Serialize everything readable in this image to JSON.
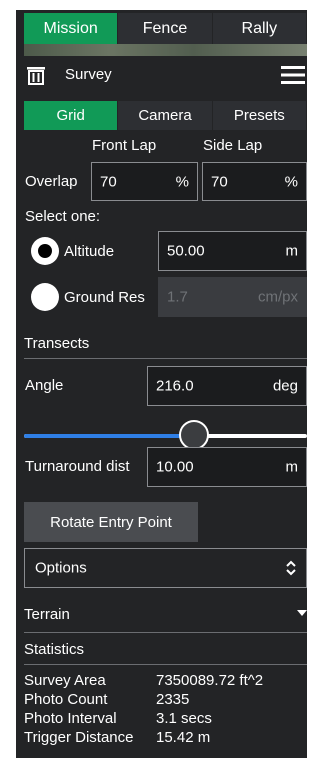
{
  "top_tabs": [
    {
      "label": "Mission",
      "active": true
    },
    {
      "label": "Fence",
      "active": false
    },
    {
      "label": "Rally",
      "active": false
    }
  ],
  "survey": {
    "title": "Survey",
    "trash_icon": "trash-icon",
    "menu_icon": "hamburger-menu-icon"
  },
  "sub_tabs": [
    {
      "label": "Grid",
      "active": true
    },
    {
      "label": "Camera",
      "active": false
    },
    {
      "label": "Presets",
      "active": false
    }
  ],
  "overlap": {
    "front_lap_label": "Front Lap",
    "side_lap_label": "Side Lap",
    "row_label": "Overlap",
    "front_value": "70",
    "front_unit": "%",
    "side_value": "70",
    "side_unit": "%"
  },
  "select_one": "Select one:",
  "altitude": {
    "label": "Altitude",
    "value": "50.00",
    "unit": "m",
    "selected": true
  },
  "ground_res": {
    "label": "Ground Res",
    "value": "1.7",
    "unit": "cm/px",
    "selected": false
  },
  "transects": {
    "title": "Transects"
  },
  "angle": {
    "label": "Angle",
    "value": "216.0",
    "unit": "deg",
    "slider_fraction": 0.6
  },
  "turnaround": {
    "label": "Turnaround dist",
    "value": "10.00",
    "unit": "m"
  },
  "rotate_entry_point": "Rotate Entry Point",
  "options": {
    "value": "Options",
    "icon": "up-down-chevron-icon"
  },
  "terrain": {
    "title": "Terrain",
    "icon": "caret-down-icon"
  },
  "statistics": {
    "title": "Statistics",
    "rows": [
      {
        "label": "Survey Area",
        "value": "7350089.72 ft^2"
      },
      {
        "label": "Photo Count",
        "value": "2335"
      },
      {
        "label": "Photo Interval",
        "value": "3.1 secs"
      },
      {
        "label": "Trigger Distance",
        "value": "15.42 m"
      }
    ]
  },
  "colors": {
    "active_tab": "#119a57",
    "panel_bg": "#232426",
    "slider_fill": "#2f7fe6"
  }
}
